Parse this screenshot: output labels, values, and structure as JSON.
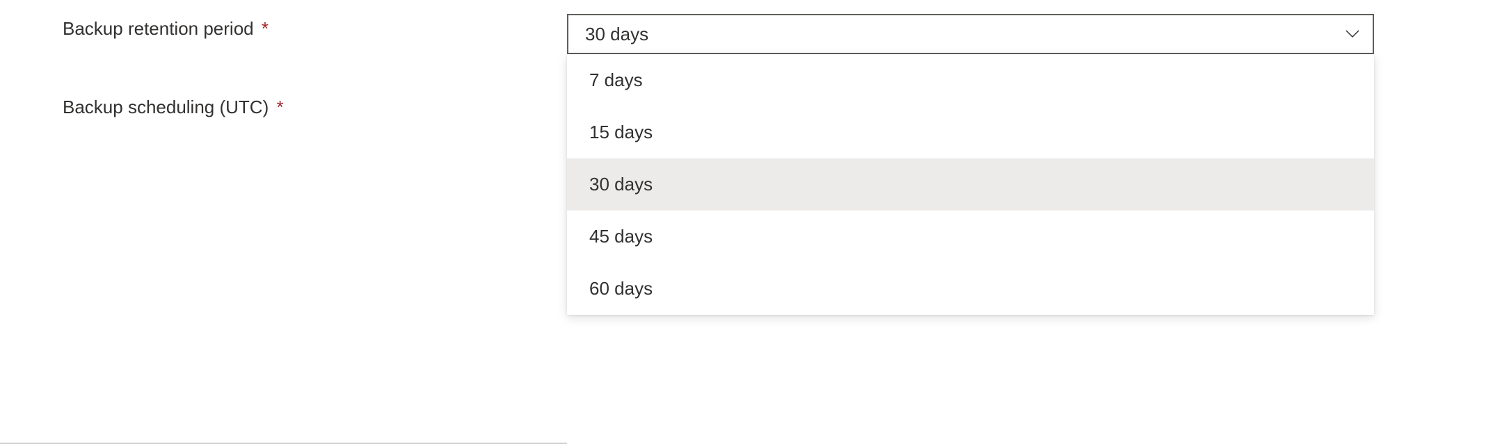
{
  "form": {
    "retention": {
      "label": "Backup retention period",
      "required_mark": "*",
      "selected_value": "30 days",
      "options": {
        "0": "7 days",
        "1": "15 days",
        "2": "30 days",
        "3": "45 days",
        "4": "60 days"
      }
    },
    "scheduling": {
      "label": "Backup scheduling (UTC)",
      "required_mark": "*"
    }
  }
}
